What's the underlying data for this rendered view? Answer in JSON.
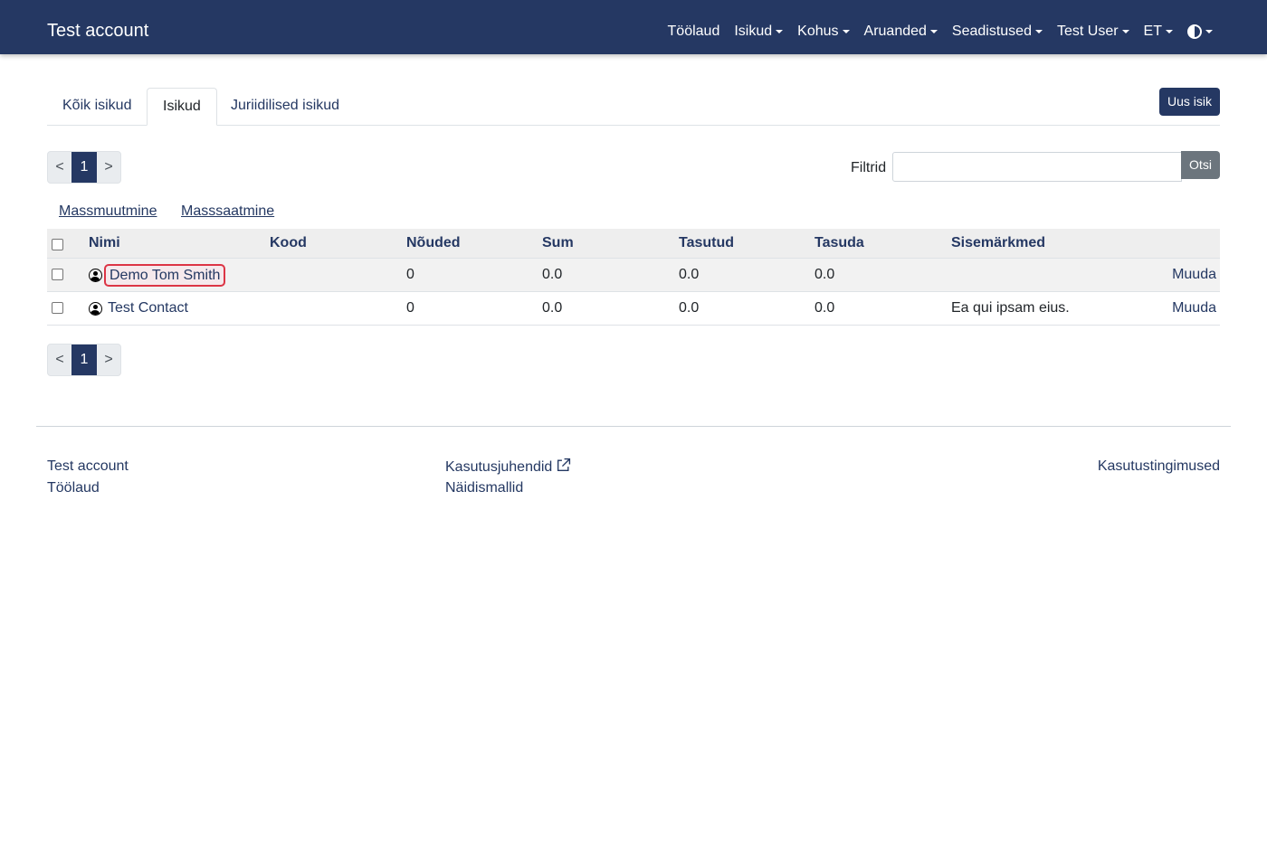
{
  "navbar": {
    "brand": "Test account",
    "items": [
      {
        "label": "Töölaud",
        "dropdown": false
      },
      {
        "label": "Isikud",
        "dropdown": true
      },
      {
        "label": "Kohus",
        "dropdown": true
      },
      {
        "label": "Aruanded",
        "dropdown": true
      },
      {
        "label": "Seadistused",
        "dropdown": true
      },
      {
        "label": "Test User",
        "dropdown": true
      },
      {
        "label": "ET",
        "dropdown": true
      }
    ],
    "theme_icon": "contrast-icon"
  },
  "tabs": [
    "Kõik isikud",
    "Isikud",
    "Juriidilised isikud"
  ],
  "active_tab": "Isikud",
  "new_person_button": "Uus isik",
  "pagination": {
    "prev": "<",
    "current": "1",
    "next": ">"
  },
  "filter": {
    "label": "Filtrid",
    "value": "",
    "button": "Otsi"
  },
  "bulk_actions": {
    "mass_edit": "Massmuutmine",
    "mass_send": "Masssaatmine"
  },
  "table": {
    "headers": [
      "Nimi",
      "Kood",
      "Nõuded",
      "Sum",
      "Tasutud",
      "Tasuda",
      "Sisemärkmed"
    ],
    "rows": [
      {
        "name": "Demo Tom Smith",
        "code": "",
        "claims": "0",
        "sum": "0.0",
        "paid": "0.0",
        "due": "0.0",
        "notes": "",
        "action": "Muuda"
      },
      {
        "name": "Test Contact",
        "code": "",
        "claims": "0",
        "sum": "0.0",
        "paid": "0.0",
        "due": "0.0",
        "notes": "Ea qui ipsam eius.",
        "action": "Muuda"
      }
    ]
  },
  "footer": {
    "account": "Test account",
    "dashboard": "Töölaud",
    "guides": "Kasutusjuhendid",
    "templates": "Näidismallid",
    "terms": "Kasutustingimused"
  },
  "colors": {
    "navbar": "#253863",
    "accent": "#243862",
    "highlight": "#dc3545",
    "secondary": "#6c757d"
  }
}
